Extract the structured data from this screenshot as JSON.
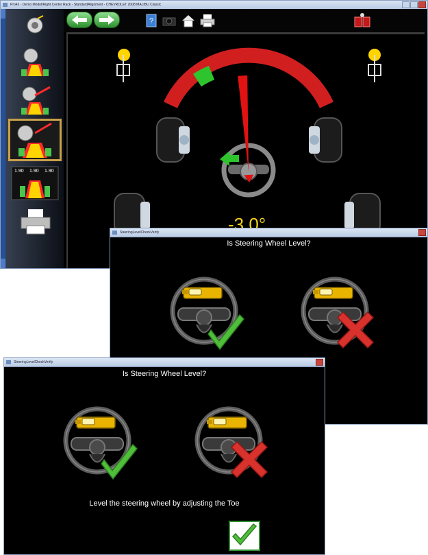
{
  "main_window": {
    "title": "Pro42 - Demo Model/Right Center Rack - StandardAlignment - CHEVROLET 2008 MALIBU Classic",
    "toolbar": {
      "back": "back-arrow-icon",
      "forward": "forward-arrow-icon",
      "help": "help-book-icon",
      "camera": "camera-icon",
      "home": "home-icon",
      "print": "printer-icon",
      "specs": "specs-icon"
    },
    "sidebar": {
      "items": [
        {
          "name": "sensor-setup-icon"
        },
        {
          "name": "caster-icon"
        },
        {
          "name": "camber-icon"
        },
        {
          "name": "steering-level-icon",
          "active": true
        },
        {
          "name": "readings-icon",
          "readings": [
            "1.90",
            "1.90",
            "1.90"
          ]
        },
        {
          "name": "printer-icon"
        }
      ]
    },
    "gauge": {
      "value": "-3.0°",
      "needle_deg": -3.0
    },
    "colors": {
      "gauge_red": "#d11f1f",
      "gauge_green": "#2ec42e",
      "readout": "#f2d11b"
    }
  },
  "dialog1": {
    "title": "SteeringLevelCheckVerify",
    "question": "Is Steering Wheel Level?"
  },
  "dialog2": {
    "title": "SteeringLevelCheckVerify",
    "question": "Is Steering Wheel Level?",
    "instruction": "Level the steering wheel by adjusting the Toe"
  }
}
